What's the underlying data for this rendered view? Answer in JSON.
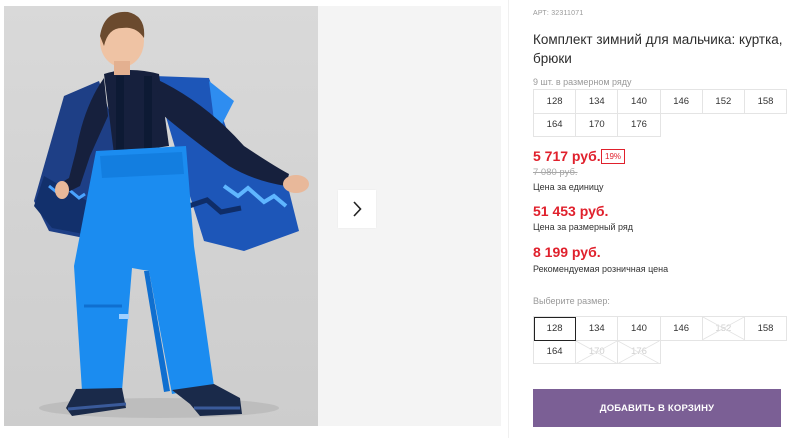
{
  "product": {
    "article": "АРТ: 32311071",
    "title": "Комплект зимний для мальчика: куртка, брюки",
    "pack_note": "9 шт. в размерном ряду",
    "pack_sizes": [
      "128",
      "134",
      "140",
      "146",
      "152",
      "158",
      "164",
      "170",
      "176"
    ]
  },
  "pricing": {
    "unit_price": "5 717 руб.",
    "discount_badge": "19%",
    "old_price": "7 080 руб.",
    "unit_label": "Цена за единицу",
    "row_price": "51 453 руб.",
    "row_label": "Цена за размерный ряд",
    "rrp_price": "8 199 руб.",
    "rrp_label": "Рекомендуемая розничная цена",
    "accent_color": "#e0202c"
  },
  "size_selector": {
    "label": "Выберите размер:",
    "sizes": [
      {
        "value": "128",
        "state": "selected"
      },
      {
        "value": "134",
        "state": "available"
      },
      {
        "value": "140",
        "state": "available"
      },
      {
        "value": "146",
        "state": "available"
      },
      {
        "value": "152",
        "state": "unavailable"
      },
      {
        "value": "158",
        "state": "available"
      },
      {
        "value": "164",
        "state": "available"
      },
      {
        "value": "170",
        "state": "unavailable"
      },
      {
        "value": "176",
        "state": "unavailable"
      }
    ]
  },
  "gallery": {
    "next_icon": "chevron-right-icon",
    "photo_alt": "boy-in-blue-winter-suit"
  },
  "actions": {
    "add_to_cart": "ДОБАВИТЬ В КОРЗИНУ",
    "button_color": "#7b5f95"
  }
}
